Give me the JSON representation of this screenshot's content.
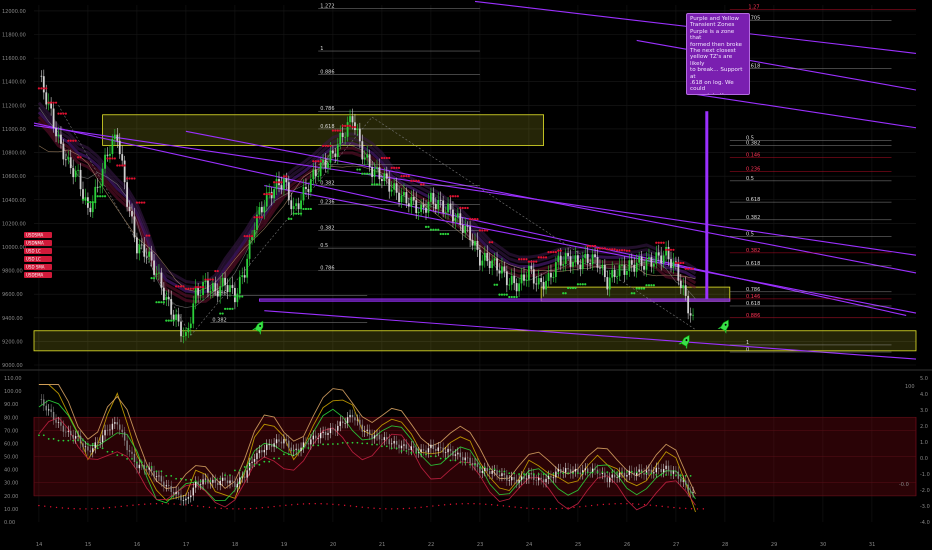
{
  "chart_data": {
    "type": "candlestick",
    "title": "",
    "x_tick_labels": [
      "14",
      "15",
      "16",
      "17",
      "18",
      "19",
      "20",
      "21",
      "22",
      "23",
      "24",
      "25",
      "26",
      "27",
      "28",
      "29",
      "30",
      "31"
    ],
    "price_axis": {
      "ticks": [
        "12000.00",
        "11800.00",
        "11600.00",
        "11400.00",
        "11200.00",
        "11000.00",
        "10800.00",
        "10600.00",
        "10400.00",
        "10200.00",
        "10000.00",
        "9800.00",
        "9600.00",
        "9400.00",
        "9200.00",
        "9000.00"
      ],
      "ylim": [
        9000,
        12050
      ]
    },
    "oscillator_axis_left": {
      "ticks": [
        "110.00",
        "100.00",
        "90.00",
        "80.00",
        "70.00",
        "60.00",
        "50.00",
        "40.00",
        "30.00",
        "20.00",
        "10.00",
        "0.00"
      ],
      "ylim": [
        0,
        110
      ]
    },
    "oscillator_axis_right": {
      "ticks": [
        "5.0",
        "4.0",
        "3.0",
        "2.0",
        "1.0",
        "0.0",
        "-1.0",
        "-2.0",
        "-3.0",
        "-4.0"
      ]
    },
    "fib_levels": [
      {
        "label": "1.272"
      },
      {
        "label": "1"
      },
      {
        "label": "0.886"
      },
      {
        "label": "0.786"
      },
      {
        "label": "0.618"
      },
      {
        "label": "0.5"
      },
      {
        "label": "0.382"
      },
      {
        "label": "0.236"
      },
      {
        "label": "0.382"
      },
      {
        "label": "0.5"
      },
      {
        "label": "0.786"
      },
      {
        "label": "0.886"
      },
      {
        "label": "0.705"
      },
      {
        "label": "0.618"
      },
      {
        "label": "0.5"
      },
      {
        "label": "0.382"
      },
      {
        "label": "0.236"
      },
      {
        "label": "0.146"
      },
      {
        "label": "0.618"
      },
      {
        "label": "0.382"
      },
      {
        "label": "0.5"
      },
      {
        "label": "0.382"
      },
      {
        "label": "0.618"
      },
      {
        "label": "0.786"
      },
      {
        "label": "0.146"
      },
      {
        "label": "0.618"
      },
      {
        "label": "0.886"
      },
      {
        "label": "1"
      },
      {
        "label": "0"
      },
      {
        "label": "1.27"
      },
      {
        "label": "0.5"
      },
      {
        "label": "0.382"
      }
    ],
    "transient_zones": [
      {
        "name": "yellow-zone-upper",
        "price_range": [
          10860,
          11120
        ],
        "day_range": [
          15.3,
          24.3
        ]
      },
      {
        "name": "yellow-zone-mid-right",
        "price_range": [
          9540,
          9660
        ],
        "day_range": [
          24.25,
          28.1
        ]
      },
      {
        "name": "yellow-zone-bottom",
        "price_range": [
          9120,
          9290
        ],
        "day_range": [
          13.9,
          31.9
        ]
      },
      {
        "name": "purple-zone",
        "price_range": [
          9540,
          9560
        ],
        "day_range": [
          18.5,
          28.1
        ]
      }
    ],
    "price_series": {
      "name": "",
      "x_days": [
        14.0,
        14.2,
        14.4,
        14.6,
        14.8,
        15.0,
        15.2,
        15.4,
        15.6,
        15.8,
        16.0,
        16.2,
        16.4,
        16.6,
        16.8,
        17.0,
        17.2,
        17.4,
        17.6,
        17.8,
        18.0,
        18.2,
        18.4,
        18.6,
        18.8,
        19.0,
        19.2,
        19.4,
        19.6,
        19.8,
        20.0,
        20.2,
        20.4,
        20.6,
        20.8,
        21.0,
        21.2,
        21.4,
        21.6,
        21.8,
        22.0,
        22.2,
        22.4,
        22.6,
        22.8,
        23.0,
        23.2,
        23.4,
        23.6,
        23.8,
        24.0,
        24.2,
        24.4,
        24.6,
        24.8,
        25.0,
        25.2,
        25.4,
        25.6,
        25.8,
        26.0,
        26.2,
        26.4,
        26.6,
        26.8,
        27.0,
        27.2,
        27.4
      ],
      "close": [
        11450,
        11200,
        10900,
        10700,
        10600,
        10300,
        10500,
        10800,
        10950,
        10400,
        10000,
        9950,
        9780,
        9550,
        9380,
        9220,
        9600,
        9680,
        9620,
        9700,
        9580,
        9800,
        10200,
        10380,
        10500,
        10560,
        10300,
        10450,
        10600,
        10700,
        10780,
        10950,
        11100,
        10800,
        10650,
        10600,
        10500,
        10420,
        10380,
        10300,
        10400,
        10350,
        10300,
        10200,
        10100,
        9900,
        9880,
        9820,
        9700,
        9680,
        9800,
        9680,
        9720,
        9880,
        9900,
        9860,
        9900,
        9880,
        9700,
        9800,
        9820,
        9860,
        9860,
        9900,
        9940,
        9820,
        9560,
        9300
      ]
    },
    "oscillator": {
      "ylabel": "",
      "annotations": [
        "100",
        "-0.0"
      ]
    },
    "annotation_note": "Purple and Yellow\nTransient Zones\nPurple is a zone that\nformed then broke\nThe next closest\nyellow TZ's are likely\nto break... Support at\n.618 on log. We could\nmove into the yellow\nTZ below, but it's less\nlikely to break anytime\nsoon",
    "left_badges": [
      {
        "label": "USDSMA",
        "color": "#d11a3a"
      },
      {
        "label": "USDNMA",
        "color": "#d11a3a"
      },
      {
        "label": "USD LC",
        "color": "#d11a3a"
      },
      {
        "label": "USD LC",
        "color": "#d11a3a"
      },
      {
        "label": "USD SMA",
        "color": "#d11a3a"
      },
      {
        "label": "USDEMA",
        "color": "#d11a3a"
      }
    ],
    "rocket_icons": 3,
    "colors": {
      "bull": "#2bd03a",
      "bear": "#cfcfcf",
      "purple": "#9b30ff",
      "yellow": "#e6e62a",
      "red": "#e01030"
    }
  }
}
